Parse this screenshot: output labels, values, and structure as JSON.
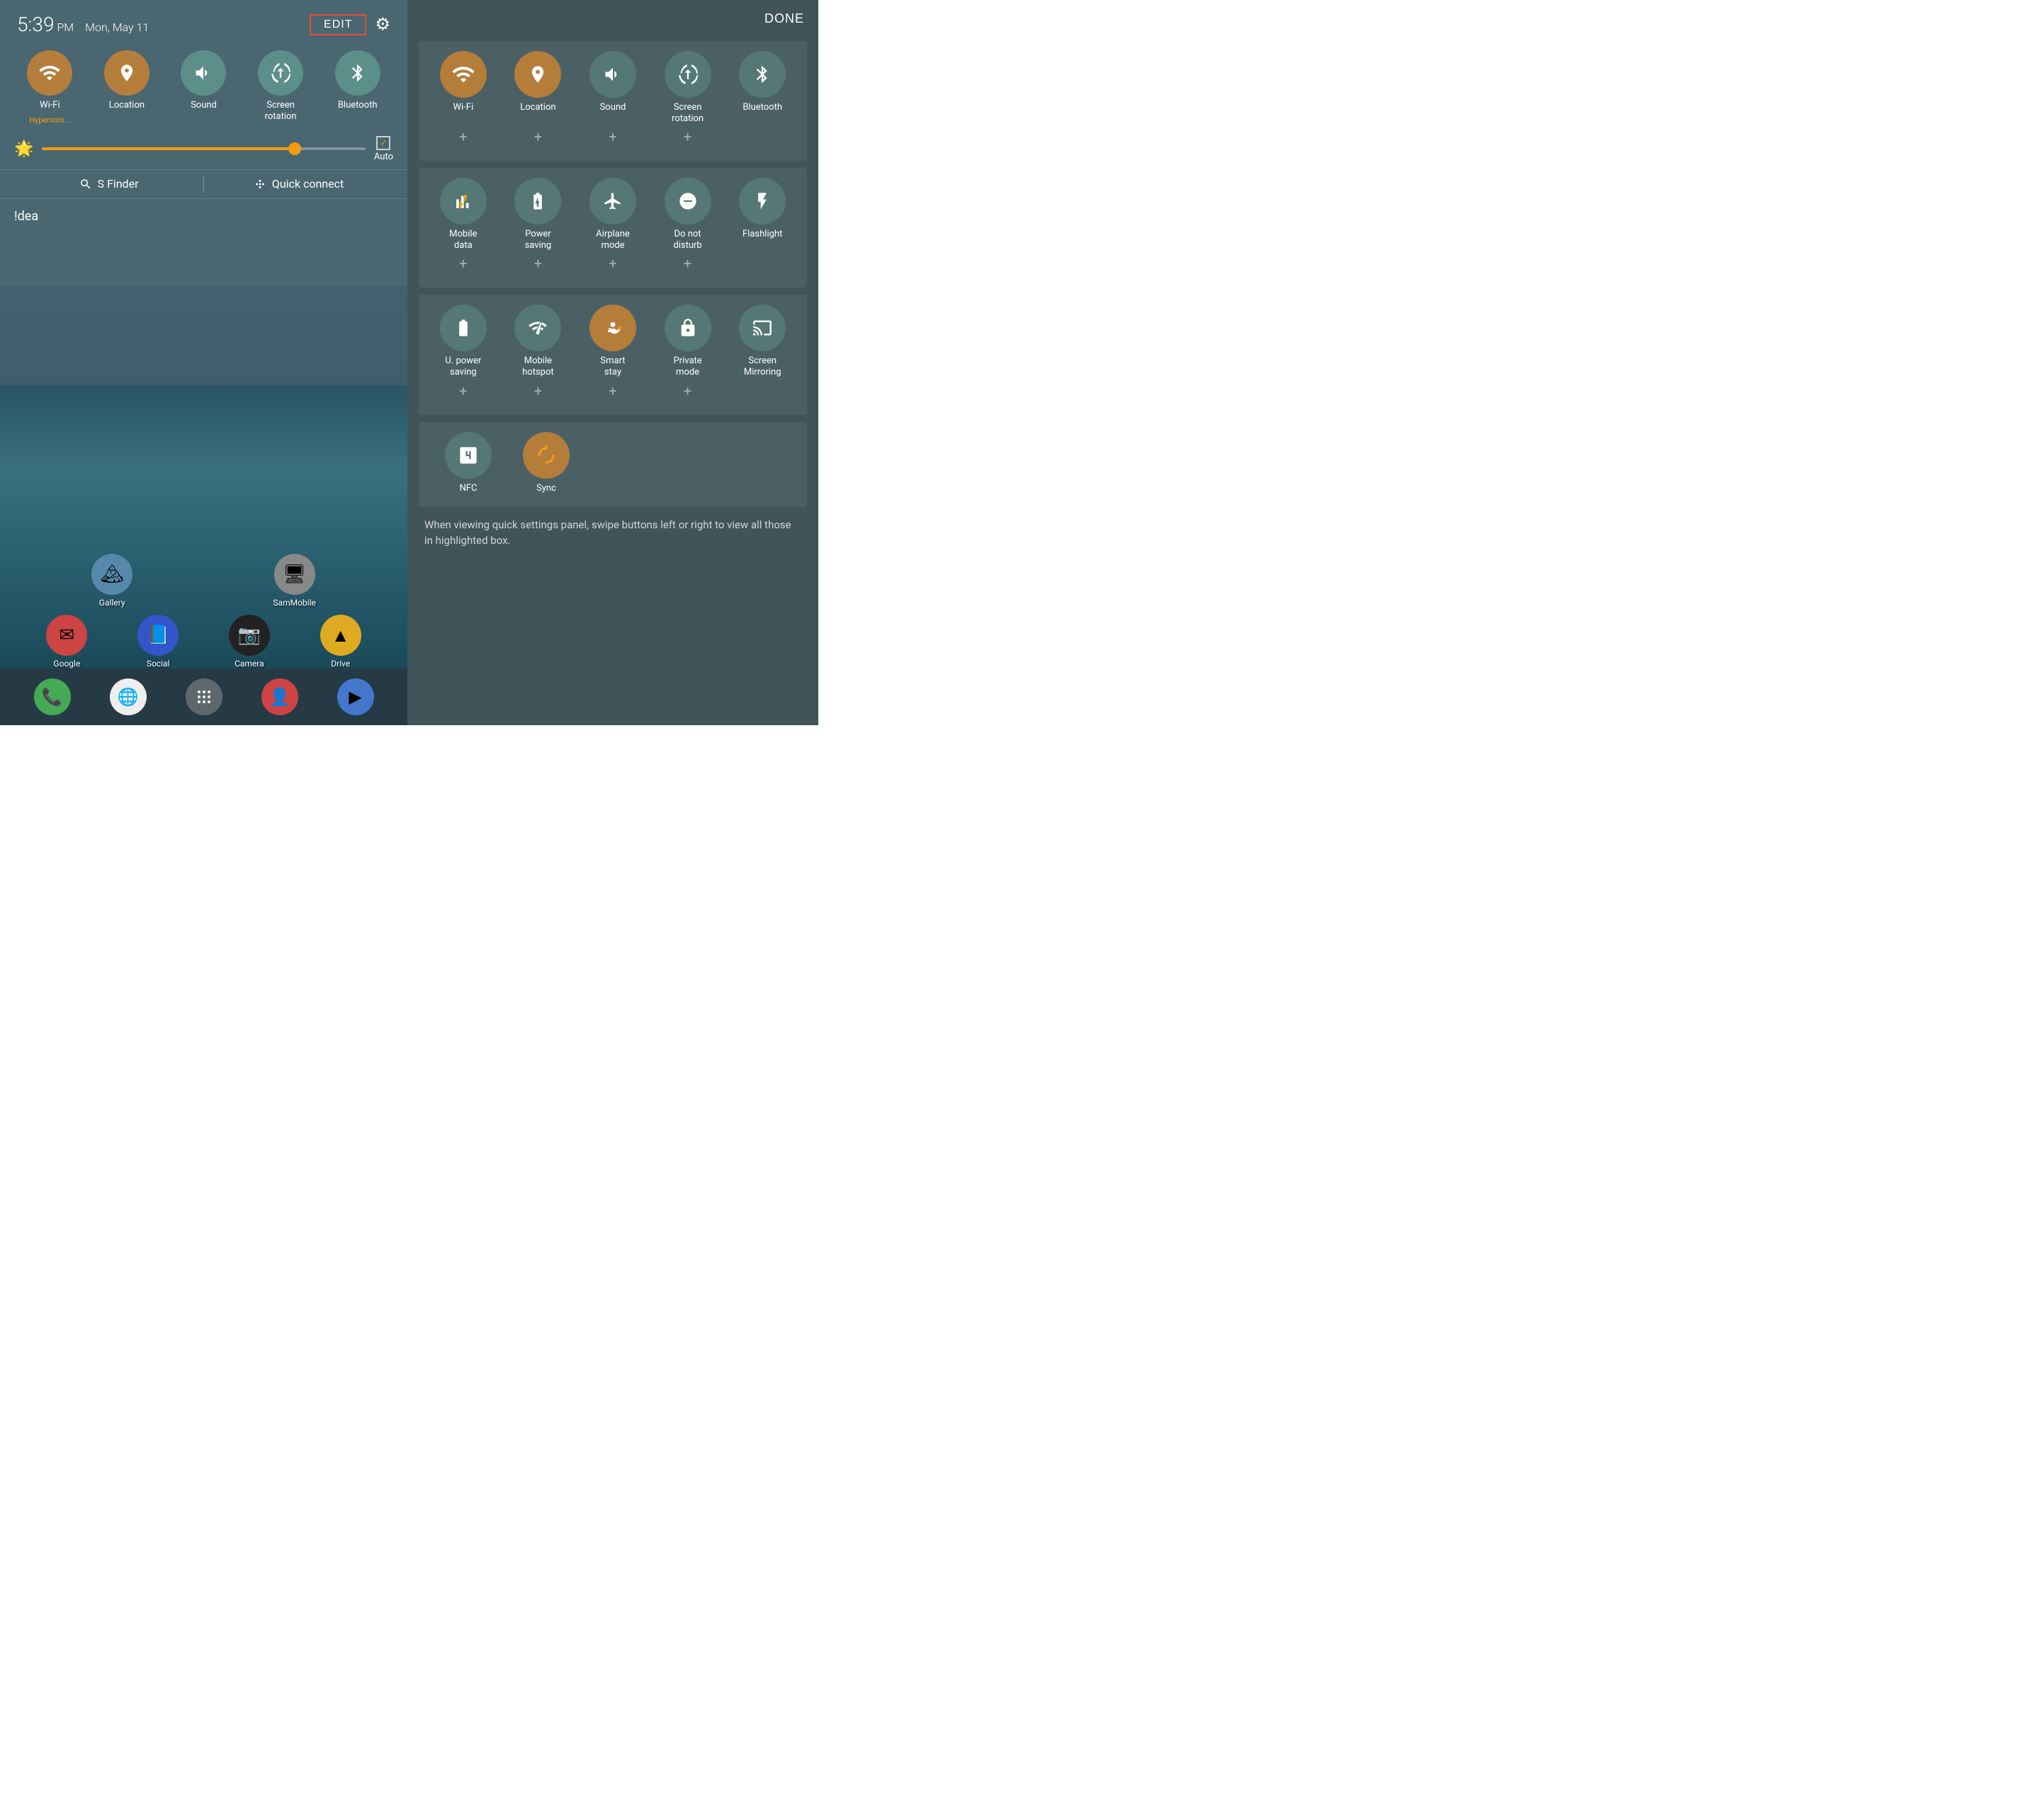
{
  "left": {
    "time": "5:39",
    "ampm": "PM",
    "date": "Mon, May 11",
    "edit_label": "EDIT",
    "tiles": [
      {
        "id": "wifi",
        "label": "Wi-Fi",
        "sub": "Hypersoni...",
        "active": true,
        "icon": "wifi"
      },
      {
        "id": "location",
        "label": "Location",
        "sub": "",
        "active": true,
        "icon": "location"
      },
      {
        "id": "sound",
        "label": "Sound",
        "sub": "",
        "active": false,
        "icon": "sound"
      },
      {
        "id": "screen-rotation",
        "label": "Screen\nrotation",
        "sub": "",
        "active": false,
        "icon": "rotation"
      },
      {
        "id": "bluetooth-left",
        "label": "Bluetooth",
        "sub": "",
        "active": false,
        "icon": "bluetooth"
      }
    ],
    "auto_label": "Auto",
    "sfinder_label": "S Finder",
    "quickconnect_label": "Quick connect",
    "idea_text": "!dea",
    "apps_row1": [
      {
        "label": "Gallery",
        "bg": "#5588aa",
        "icon": "🏔"
      },
      {
        "label": "SamMobile",
        "bg": "#888888",
        "icon": "🖥"
      }
    ],
    "apps_row2": [
      {
        "label": "Google",
        "bg": "#cc4444",
        "icon": "✉"
      },
      {
        "label": "Social",
        "bg": "#3355cc",
        "icon": "📘"
      },
      {
        "label": "Camera",
        "bg": "#222222",
        "icon": "📷"
      },
      {
        "label": "Drive",
        "bg": "#ddaa22",
        "icon": "▲"
      }
    ],
    "dock": [
      {
        "label": "Phone",
        "bg": "#44aa55",
        "icon": "📞"
      },
      {
        "label": "Chrome",
        "bg": "#dddddd",
        "icon": "🌐"
      },
      {
        "label": "Apps",
        "bg": "#888888",
        "icon": "⋯"
      },
      {
        "label": "Contacts",
        "bg": "#cc4444",
        "icon": "👤"
      },
      {
        "label": "Play Store",
        "bg": "#4477cc",
        "icon": "▶"
      }
    ]
  },
  "right": {
    "done_label": "DONE",
    "section1": {
      "tiles": [
        {
          "id": "wifi2",
          "label": "Wi-Fi",
          "active": true,
          "icon": "wifi"
        },
        {
          "id": "location2",
          "label": "Location",
          "active": true,
          "icon": "location"
        },
        {
          "id": "sound2",
          "label": "Sound",
          "active": false,
          "icon": "sound"
        },
        {
          "id": "screen-rotation2",
          "label": "Screen\nrotation",
          "active": false,
          "icon": "rotation"
        },
        {
          "id": "bluetooth2",
          "label": "Bluetooth",
          "active": false,
          "icon": "bluetooth"
        }
      ]
    },
    "section2": {
      "tiles": [
        {
          "id": "mobile-data",
          "label": "Mobile\ndata",
          "active": true,
          "icon": "mobile-data"
        },
        {
          "id": "power-saving",
          "label": "Power\nsaving",
          "active": false,
          "icon": "power-saving"
        },
        {
          "id": "airplane",
          "label": "Airplane\nmode",
          "active": false,
          "icon": "airplane"
        },
        {
          "id": "do-not-disturb",
          "label": "Do not\ndisturb",
          "active": false,
          "icon": "dnd"
        },
        {
          "id": "flashlight",
          "label": "Flashlight",
          "active": false,
          "icon": "flashlight"
        }
      ]
    },
    "section3": {
      "tiles": [
        {
          "id": "u-power",
          "label": "U. power\nsaving",
          "active": false,
          "icon": "u-power"
        },
        {
          "id": "mobile-hotspot",
          "label": "Mobile\nhotspot",
          "active": false,
          "icon": "hotspot"
        },
        {
          "id": "smart-stay",
          "label": "Smart\nstay",
          "active": true,
          "icon": "smart-stay"
        },
        {
          "id": "private-mode",
          "label": "Private\nmode",
          "active": false,
          "icon": "private"
        },
        {
          "id": "screen-mirroring",
          "label": "Screen\nMirroring",
          "active": false,
          "icon": "mirroring"
        }
      ]
    },
    "section4": {
      "tiles": [
        {
          "id": "nfc",
          "label": "NFC",
          "active": false,
          "icon": "nfc"
        },
        {
          "id": "sync",
          "label": "Sync",
          "active": true,
          "icon": "sync"
        }
      ]
    },
    "hint_text": "When viewing quick settings panel, swipe buttons left or right to view all those in highlighted box."
  }
}
